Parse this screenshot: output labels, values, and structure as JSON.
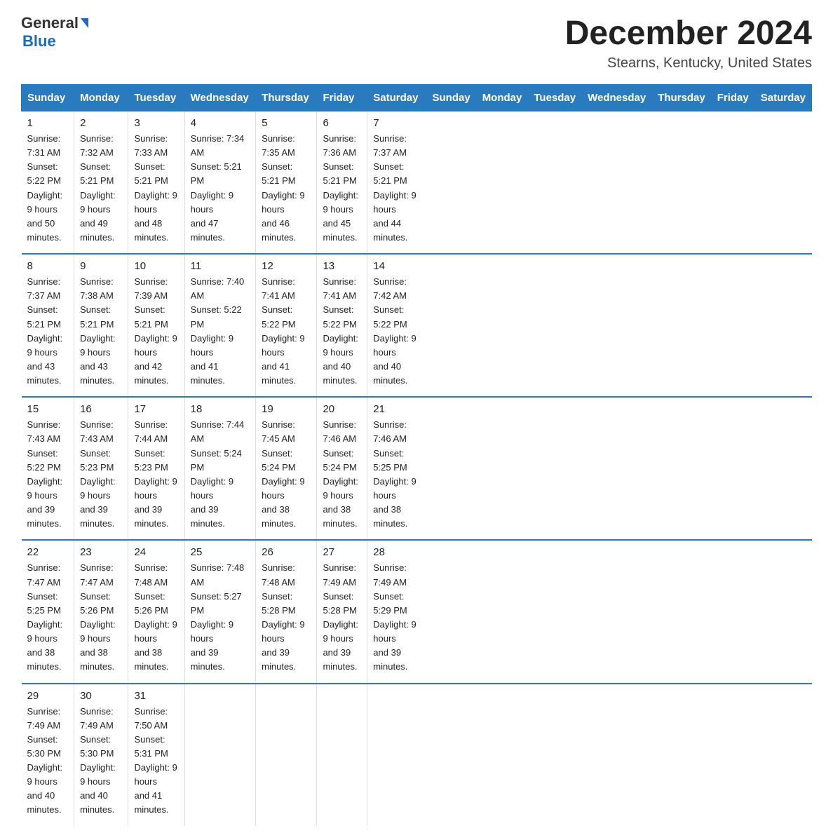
{
  "header": {
    "logo_general": "General",
    "logo_blue": "Blue",
    "title": "December 2024",
    "subtitle": "Stearns, Kentucky, United States"
  },
  "days_of_week": [
    "Sunday",
    "Monday",
    "Tuesday",
    "Wednesday",
    "Thursday",
    "Friday",
    "Saturday"
  ],
  "weeks": [
    [
      {
        "num": "1",
        "sunrise": "7:31 AM",
        "sunset": "5:22 PM",
        "daylight": "9 hours and 50 minutes."
      },
      {
        "num": "2",
        "sunrise": "7:32 AM",
        "sunset": "5:21 PM",
        "daylight": "9 hours and 49 minutes."
      },
      {
        "num": "3",
        "sunrise": "7:33 AM",
        "sunset": "5:21 PM",
        "daylight": "9 hours and 48 minutes."
      },
      {
        "num": "4",
        "sunrise": "7:34 AM",
        "sunset": "5:21 PM",
        "daylight": "9 hours and 47 minutes."
      },
      {
        "num": "5",
        "sunrise": "7:35 AM",
        "sunset": "5:21 PM",
        "daylight": "9 hours and 46 minutes."
      },
      {
        "num": "6",
        "sunrise": "7:36 AM",
        "sunset": "5:21 PM",
        "daylight": "9 hours and 45 minutes."
      },
      {
        "num": "7",
        "sunrise": "7:37 AM",
        "sunset": "5:21 PM",
        "daylight": "9 hours and 44 minutes."
      }
    ],
    [
      {
        "num": "8",
        "sunrise": "7:37 AM",
        "sunset": "5:21 PM",
        "daylight": "9 hours and 43 minutes."
      },
      {
        "num": "9",
        "sunrise": "7:38 AM",
        "sunset": "5:21 PM",
        "daylight": "9 hours and 43 minutes."
      },
      {
        "num": "10",
        "sunrise": "7:39 AM",
        "sunset": "5:21 PM",
        "daylight": "9 hours and 42 minutes."
      },
      {
        "num": "11",
        "sunrise": "7:40 AM",
        "sunset": "5:22 PM",
        "daylight": "9 hours and 41 minutes."
      },
      {
        "num": "12",
        "sunrise": "7:41 AM",
        "sunset": "5:22 PM",
        "daylight": "9 hours and 41 minutes."
      },
      {
        "num": "13",
        "sunrise": "7:41 AM",
        "sunset": "5:22 PM",
        "daylight": "9 hours and 40 minutes."
      },
      {
        "num": "14",
        "sunrise": "7:42 AM",
        "sunset": "5:22 PM",
        "daylight": "9 hours and 40 minutes."
      }
    ],
    [
      {
        "num": "15",
        "sunrise": "7:43 AM",
        "sunset": "5:22 PM",
        "daylight": "9 hours and 39 minutes."
      },
      {
        "num": "16",
        "sunrise": "7:43 AM",
        "sunset": "5:23 PM",
        "daylight": "9 hours and 39 minutes."
      },
      {
        "num": "17",
        "sunrise": "7:44 AM",
        "sunset": "5:23 PM",
        "daylight": "9 hours and 39 minutes."
      },
      {
        "num": "18",
        "sunrise": "7:44 AM",
        "sunset": "5:24 PM",
        "daylight": "9 hours and 39 minutes."
      },
      {
        "num": "19",
        "sunrise": "7:45 AM",
        "sunset": "5:24 PM",
        "daylight": "9 hours and 38 minutes."
      },
      {
        "num": "20",
        "sunrise": "7:46 AM",
        "sunset": "5:24 PM",
        "daylight": "9 hours and 38 minutes."
      },
      {
        "num": "21",
        "sunrise": "7:46 AM",
        "sunset": "5:25 PM",
        "daylight": "9 hours and 38 minutes."
      }
    ],
    [
      {
        "num": "22",
        "sunrise": "7:47 AM",
        "sunset": "5:25 PM",
        "daylight": "9 hours and 38 minutes."
      },
      {
        "num": "23",
        "sunrise": "7:47 AM",
        "sunset": "5:26 PM",
        "daylight": "9 hours and 38 minutes."
      },
      {
        "num": "24",
        "sunrise": "7:48 AM",
        "sunset": "5:26 PM",
        "daylight": "9 hours and 38 minutes."
      },
      {
        "num": "25",
        "sunrise": "7:48 AM",
        "sunset": "5:27 PM",
        "daylight": "9 hours and 39 minutes."
      },
      {
        "num": "26",
        "sunrise": "7:48 AM",
        "sunset": "5:28 PM",
        "daylight": "9 hours and 39 minutes."
      },
      {
        "num": "27",
        "sunrise": "7:49 AM",
        "sunset": "5:28 PM",
        "daylight": "9 hours and 39 minutes."
      },
      {
        "num": "28",
        "sunrise": "7:49 AM",
        "sunset": "5:29 PM",
        "daylight": "9 hours and 39 minutes."
      }
    ],
    [
      {
        "num": "29",
        "sunrise": "7:49 AM",
        "sunset": "5:30 PM",
        "daylight": "9 hours and 40 minutes."
      },
      {
        "num": "30",
        "sunrise": "7:49 AM",
        "sunset": "5:30 PM",
        "daylight": "9 hours and 40 minutes."
      },
      {
        "num": "31",
        "sunrise": "7:50 AM",
        "sunset": "5:31 PM",
        "daylight": "9 hours and 41 minutes."
      },
      null,
      null,
      null,
      null
    ]
  ],
  "labels": {
    "sunrise": "Sunrise:",
    "sunset": "Sunset:",
    "daylight": "Daylight:"
  }
}
